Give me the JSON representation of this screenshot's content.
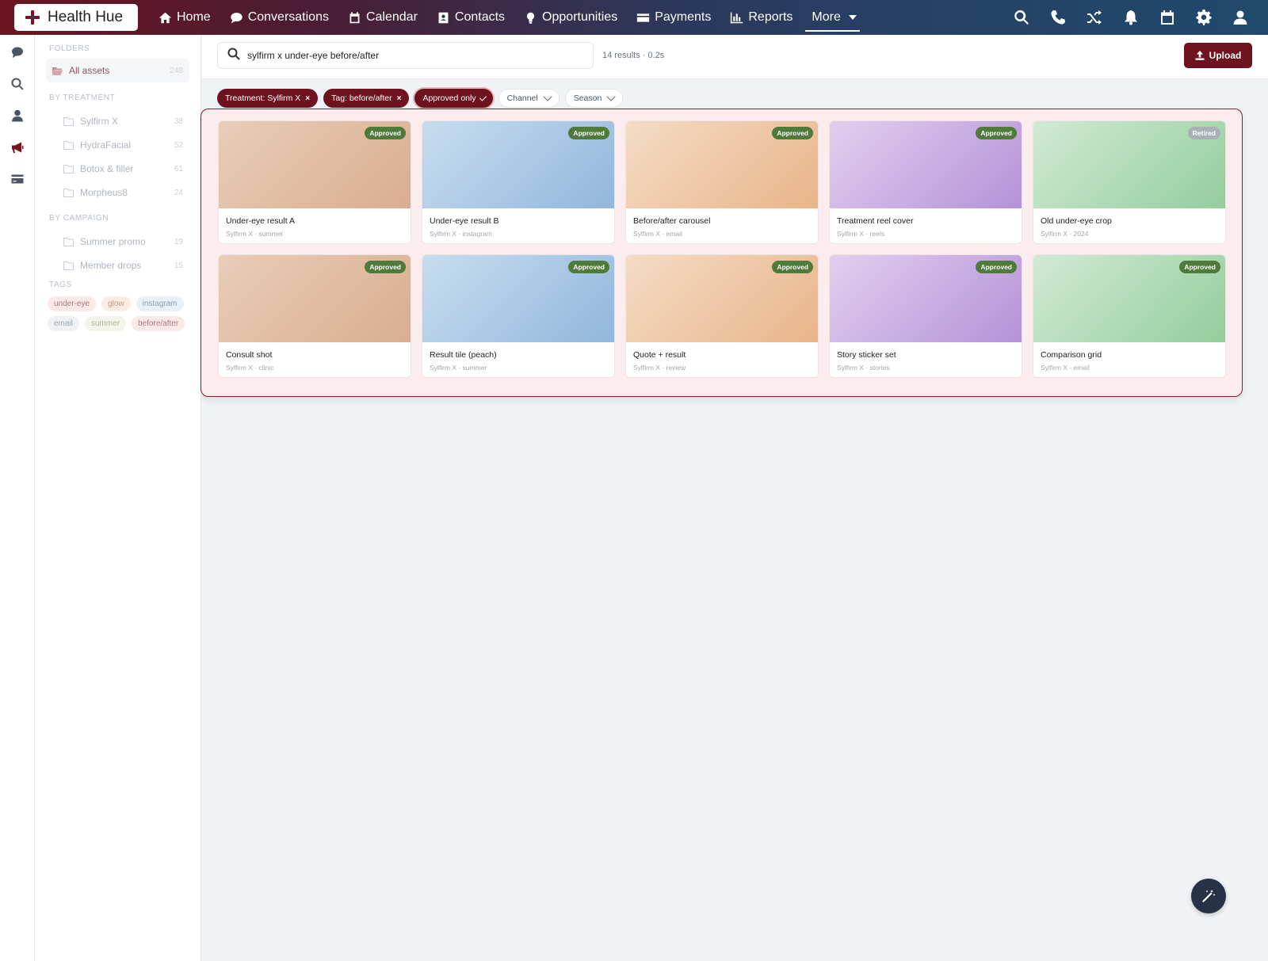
{
  "app": {
    "name": "Health Hue"
  },
  "nav": {
    "items": [
      {
        "label": "Home",
        "icon": "home-icon"
      },
      {
        "label": "Conversations",
        "icon": "chat-icon"
      },
      {
        "label": "Calendar",
        "icon": "calendar-icon"
      },
      {
        "label": "Contacts",
        "icon": "contact-card-icon"
      },
      {
        "label": "Opportunities",
        "icon": "lightbulb-icon"
      },
      {
        "label": "Payments",
        "icon": "credit-card-icon"
      },
      {
        "label": "Reports",
        "icon": "bar-chart-icon"
      }
    ],
    "more_label": "More",
    "right_icons": [
      "search-icon",
      "phone-icon",
      "shuffle-icon",
      "bell-icon",
      "calendar-icon",
      "gear-icon",
      "user-icon"
    ]
  },
  "rail": {
    "icons": [
      "chat-icon",
      "search-icon",
      "user-icon",
      "megaphone-icon",
      "card-icon"
    ],
    "active": "megaphone-icon"
  },
  "sidebar": {
    "folders_title": "FOLDERS",
    "all_assets": {
      "label": "All assets",
      "count": "248"
    },
    "treatment_title": "BY TREATMENT",
    "treatments": [
      {
        "label": "Sylfirm X",
        "count": "38"
      },
      {
        "label": "HydraFacial",
        "count": "52"
      },
      {
        "label": "Botox & filler",
        "count": "61"
      },
      {
        "label": "Morpheus8",
        "count": "24"
      }
    ],
    "campaign_title": "BY CAMPAIGN",
    "campaigns": [
      {
        "label": "Summer promo",
        "count": "19"
      },
      {
        "label": "Member drops",
        "count": "15"
      }
    ],
    "tags_title": "TAGS",
    "tags": [
      {
        "label": "under-eye",
        "bg": "#fbe9ea",
        "color": "#b07880"
      },
      {
        "label": "glow",
        "bg": "#fbede4",
        "color": "#c49a80"
      },
      {
        "label": "instagram",
        "bg": "#e8f0f8",
        "color": "#8aa2b8"
      },
      {
        "label": "email",
        "bg": "#eef2f6",
        "color": "#9aa6b4"
      },
      {
        "label": "summer",
        "bg": "#f4f5ea",
        "color": "#b0b49a"
      },
      {
        "label": "before/after",
        "bg": "#fbe9ea",
        "color": "#b07880"
      }
    ]
  },
  "search": {
    "value": "sylfirm x under-eye before/after",
    "results": "14 results · 0.2s"
  },
  "upload": {
    "label": "Upload"
  },
  "filters": {
    "active": [
      {
        "label": "Treatment: Sylfirm X",
        "mark": "×"
      },
      {
        "label": "Tag: before/after",
        "mark": "×"
      },
      {
        "label": "Approved only",
        "mark": "check"
      }
    ],
    "dropdowns": [
      {
        "label": "Channel"
      },
      {
        "label": "Season"
      }
    ]
  },
  "colors": {
    "brand": "#6e1220",
    "approved": "#4e7a3a",
    "retired": "#a9b0b8",
    "thumb_peach": [
      "#e8cdb8",
      "#d9ad90"
    ],
    "thumb_blue": [
      "#c6ddef",
      "#93b6dc"
    ],
    "thumb_orange": [
      "#f4dcc6",
      "#e9b488"
    ],
    "thumb_lavender": [
      "#e2cfef",
      "#b591d8"
    ],
    "thumb_green": [
      "#d2ead4",
      "#93cd9c"
    ]
  },
  "assets": [
    {
      "title": "Under-eye result A",
      "meta": "Sylfirm X · summer",
      "status": "Approved",
      "thumb": "peach"
    },
    {
      "title": "Under-eye result B",
      "meta": "Sylfirm X · instagram",
      "status": "Approved",
      "thumb": "blue"
    },
    {
      "title": "Before/after carousel",
      "meta": "Sylfirm X · email",
      "status": "Approved",
      "thumb": "orange"
    },
    {
      "title": "Treatment reel cover",
      "meta": "Sylfirm X · reels",
      "status": "Approved",
      "thumb": "lavender"
    },
    {
      "title": "Old under-eye crop",
      "meta": "Sylfirm X · 2024",
      "status": "Retired",
      "thumb": "green"
    },
    {
      "title": "Consult shot",
      "meta": "Sylfirm X · clinic",
      "status": "Approved",
      "thumb": "peach"
    },
    {
      "title": "Result tile (peach)",
      "meta": "Sylfirm X · summer",
      "status": "Approved",
      "thumb": "blue"
    },
    {
      "title": "Quote + result",
      "meta": "Sylfirm X · review",
      "status": "Approved",
      "thumb": "orange"
    },
    {
      "title": "Story sticker set",
      "meta": "Sylfirm X · stories",
      "status": "Approved",
      "thumb": "lavender"
    },
    {
      "title": "Comparison grid",
      "meta": "Sylfirm X · email",
      "status": "Approved",
      "thumb": "green"
    }
  ]
}
